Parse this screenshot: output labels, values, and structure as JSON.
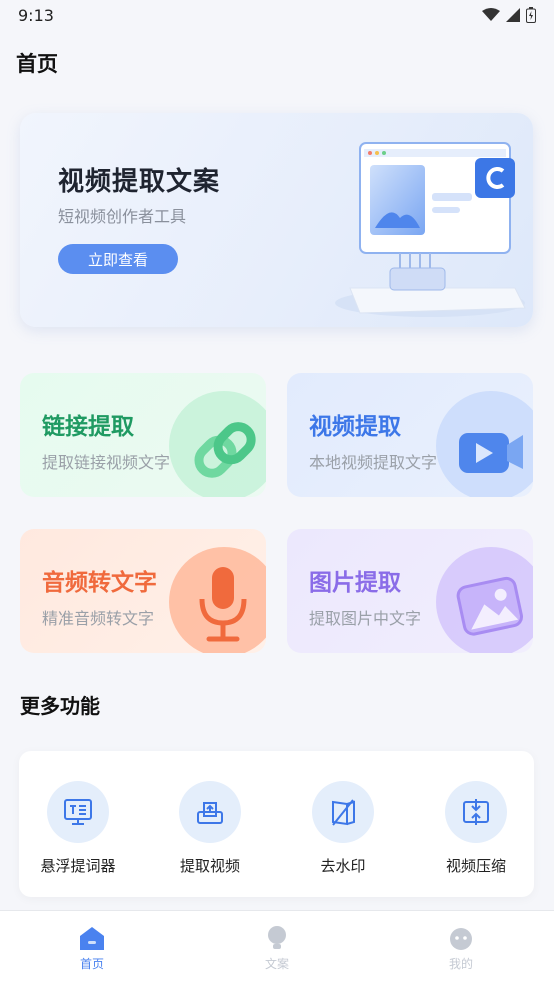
{
  "status": {
    "time": "9:13"
  },
  "header": {
    "title": "首页"
  },
  "banner": {
    "title": "视频提取文案",
    "subtitle": "短视频创作者工具",
    "button_label": "立即查看"
  },
  "cards": [
    {
      "title": "链接提取",
      "subtitle": "提取链接视频文字",
      "icon": "link-icon",
      "accent": "#1f9a62"
    },
    {
      "title": "视频提取",
      "subtitle": "本地视频提取文字",
      "icon": "video-icon",
      "accent": "#3d77e8"
    },
    {
      "title": "音频转文字",
      "subtitle": "精准音频转文字",
      "icon": "microphone-icon",
      "accent": "#f06a3d"
    },
    {
      "title": "图片提取",
      "subtitle": "提取图片中文字",
      "icon": "image-icon",
      "accent": "#8a6ce8"
    }
  ],
  "more": {
    "title": "更多功能",
    "tools": [
      {
        "label": "悬浮提词器",
        "icon": "teleprompter-icon"
      },
      {
        "label": "提取视频",
        "icon": "upload-video-icon"
      },
      {
        "label": "去水印",
        "icon": "remove-watermark-icon"
      },
      {
        "label": "视频压缩",
        "icon": "compress-icon"
      }
    ]
  },
  "nav": {
    "items": [
      {
        "label": "首页",
        "icon": "home-icon",
        "active": true
      },
      {
        "label": "文案",
        "icon": "bulb-icon",
        "active": false
      },
      {
        "label": "我的",
        "icon": "profile-icon",
        "active": false
      }
    ]
  },
  "colors": {
    "primary": "#5b8ef0",
    "nav_active": "#4a82ef",
    "nav_inactive": "#c5cad3"
  }
}
